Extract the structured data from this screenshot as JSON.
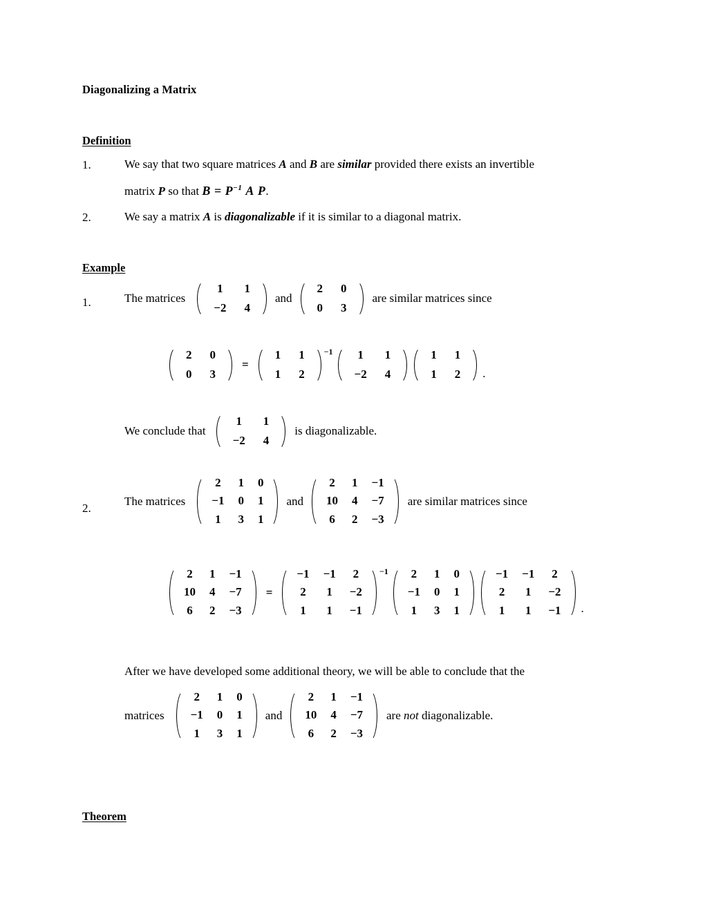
{
  "document": {
    "title": "Diagonalizing a Matrix",
    "sections": {
      "definition_heading": "Definition",
      "example_heading": "Example",
      "theorem_heading": "Theorem"
    }
  },
  "definition": {
    "items": [
      {
        "number": "1.",
        "line1_a": "We say that two square matrices ",
        "line1_var_a": "A",
        "line1_b": " and ",
        "line1_var_b": "B",
        "line1_c": " are ",
        "line1_emph": "similar",
        "line1_d": " provided there exists an invertible",
        "line2_a": "matrix ",
        "line2_var": "P",
        "line2_b": " so that ",
        "formula_b": "B",
        "formula_eq": "=",
        "formula_p": "P",
        "formula_exp": "−1",
        "formula_a": "A",
        "formula_p2": "P",
        "formula_period": "."
      },
      {
        "number": "2.",
        "text_a": "We say a matrix ",
        "text_var": "A",
        "text_b": " is ",
        "text_emph": "diagonalizable",
        "text_c": " if it is similar to a diagonal matrix."
      }
    ]
  },
  "example": {
    "items": [
      {
        "number": "1.",
        "lead": "The matrices",
        "conj": "and",
        "tail": "are similar matrices since",
        "matrix_a": [
          [
            "1",
            "1"
          ],
          [
            "−2",
            "4"
          ]
        ],
        "matrix_b": [
          [
            "2",
            "0"
          ],
          [
            "0",
            "3"
          ]
        ],
        "equation": {
          "lhs": [
            [
              "2",
              "0"
            ],
            [
              "0",
              "3"
            ]
          ],
          "equals": "=",
          "p_inv": [
            [
              "1",
              "1"
            ],
            [
              "1",
              "2"
            ]
          ],
          "exponent": "−1",
          "a": [
            [
              "1",
              "1"
            ],
            [
              "−2",
              "4"
            ]
          ],
          "p": [
            [
              "1",
              "1"
            ],
            [
              "1",
              "2"
            ]
          ],
          "period": "."
        },
        "conclusion": {
          "lead": "We conclude that",
          "matrix": [
            [
              "1",
              "1"
            ],
            [
              "−2",
              "4"
            ]
          ],
          "tail": "is diagonalizable."
        }
      },
      {
        "number": "2.",
        "lead": "The matrices",
        "conj": "and",
        "tail": "are similar matrices since",
        "matrix_a": [
          [
            "2",
            "1",
            "0"
          ],
          [
            "−1",
            "0",
            "1"
          ],
          [
            "1",
            "3",
            "1"
          ]
        ],
        "matrix_b": [
          [
            "2",
            "1",
            "−1"
          ],
          [
            "10",
            "4",
            "−7"
          ],
          [
            "6",
            "2",
            "−3"
          ]
        ],
        "equation": {
          "lhs": [
            [
              "2",
              "1",
              "−1"
            ],
            [
              "10",
              "4",
              "−7"
            ],
            [
              "6",
              "2",
              "−3"
            ]
          ],
          "equals": "=",
          "p_inv": [
            [
              "−1",
              "−1",
              "2"
            ],
            [
              "2",
              "1",
              "−2"
            ],
            [
              "1",
              "1",
              "−1"
            ]
          ],
          "exponent": "−1",
          "a": [
            [
              "2",
              "1",
              "0"
            ],
            [
              "−1",
              "0",
              "1"
            ],
            [
              "1",
              "3",
              "1"
            ]
          ],
          "p": [
            [
              "−1",
              "−1",
              "2"
            ],
            [
              "2",
              "1",
              "−2"
            ],
            [
              "1",
              "1",
              "−1"
            ]
          ],
          "period": "."
        },
        "closing": {
          "paragraph": "After we have developed some additional theory, we will be able to conclude that the",
          "lead": "matrices",
          "conj": "and",
          "tail_a": "are ",
          "tail_emph": "not",
          "tail_b": " diagonalizable.",
          "matrix_a": [
            [
              "2",
              "1",
              "0"
            ],
            [
              "−1",
              "0",
              "1"
            ],
            [
              "1",
              "3",
              "1"
            ]
          ],
          "matrix_b": [
            [
              "2",
              "1",
              "−1"
            ],
            [
              "10",
              "4",
              "−7"
            ],
            [
              "6",
              "2",
              "−3"
            ]
          ]
        }
      }
    ]
  }
}
